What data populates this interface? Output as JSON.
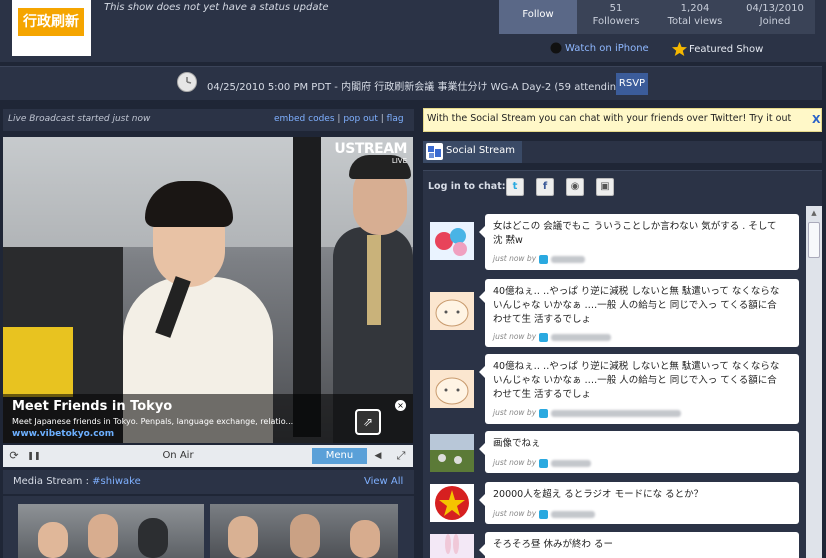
{
  "header": {
    "logo_text": "行政刷新",
    "status_text": "This show does not yet have a status update",
    "follow_label": "Follow",
    "followers_count": "51",
    "followers_label": "Followers",
    "views_count": "1,204",
    "views_label": "Total views",
    "joined_date": "04/13/2010",
    "joined_label": "Joined",
    "watch_label": "Watch on iPhone",
    "featured_label": "Featured Show"
  },
  "event": {
    "datetime_text": "04/25/2010 5:00 PM PDT - 内閣府  行政刷新会議  事業仕分け WG-A Day-2 (59 attending)",
    "rsvp_label": "RSVP"
  },
  "live": {
    "status_text": "Live Broadcast started just now",
    "embed_label": "embed codes",
    "popout_label": "pop out",
    "flag_label": "flag",
    "separator": "|"
  },
  "video": {
    "brand": "USTREAM",
    "live_badge": "LIVE",
    "ad_title": "Meet Friends in Tokyo",
    "ad_description": "Meet Japanese friends in Tokyo. Penpals, language exchange, relatio...",
    "ad_url": "www.vibetokyo.com",
    "ad_close": "×",
    "ad_popup_icon": "⇗"
  },
  "controls": {
    "refresh_icon": "⟳",
    "pause_icon": "❚❚",
    "status": "On Air",
    "menu_label": "Menu",
    "volume_icon": "◀",
    "fullscreen_icon": "⤢"
  },
  "media": {
    "title": "Media Stream :",
    "tag": "#shiwake",
    "view_all": "View All"
  },
  "social": {
    "twitter_banner": "With the Social Stream you can chat with your friends over Twitter! Try it out",
    "twitter_close": "X",
    "tab_label": "Social Stream",
    "login_label": "Log in to chat:",
    "login_icons": [
      "t",
      "f",
      "◉",
      "▣"
    ],
    "scroll_up": "▲"
  },
  "chat": [
    {
      "message": "女はどこの 会議でもこ ういうことしか言わない 気がする . そして沈 黙w",
      "time": "just now by"
    },
    {
      "message": "40億ねぇ‥ ‥やっぱ り逆に減税 しないと無 駄遣いって なくならないんじゃな いかなぁ ‥‥一般 人の給与と 同じで入っ てくる額に合わせて生 活するでしょ",
      "time": "just now by"
    },
    {
      "message": "40億ねぇ‥ ‥やっぱ り逆に減税 しないと無 駄遣いって なくならないんじゃな いかなぁ ‥‥一般 人の給与と 同じで入っ てくる額に合わせて生 活するでしょ",
      "time": "just now by"
    },
    {
      "message": "画像でねぇ",
      "time": "just now by"
    },
    {
      "message": "20000人を超え るとラジオ モードにな るとか？",
      "time": "just now by"
    },
    {
      "message": "そろそろ昼 休みが終わ るー",
      "time": ""
    }
  ],
  "colors": {
    "background": "#1f2636",
    "panel": "#2b3346",
    "link": "#7fb0ff",
    "logo_orange": "#f5a500",
    "menu_blue": "#5aa0d8",
    "twitter_blue": "#2aa9e0"
  }
}
